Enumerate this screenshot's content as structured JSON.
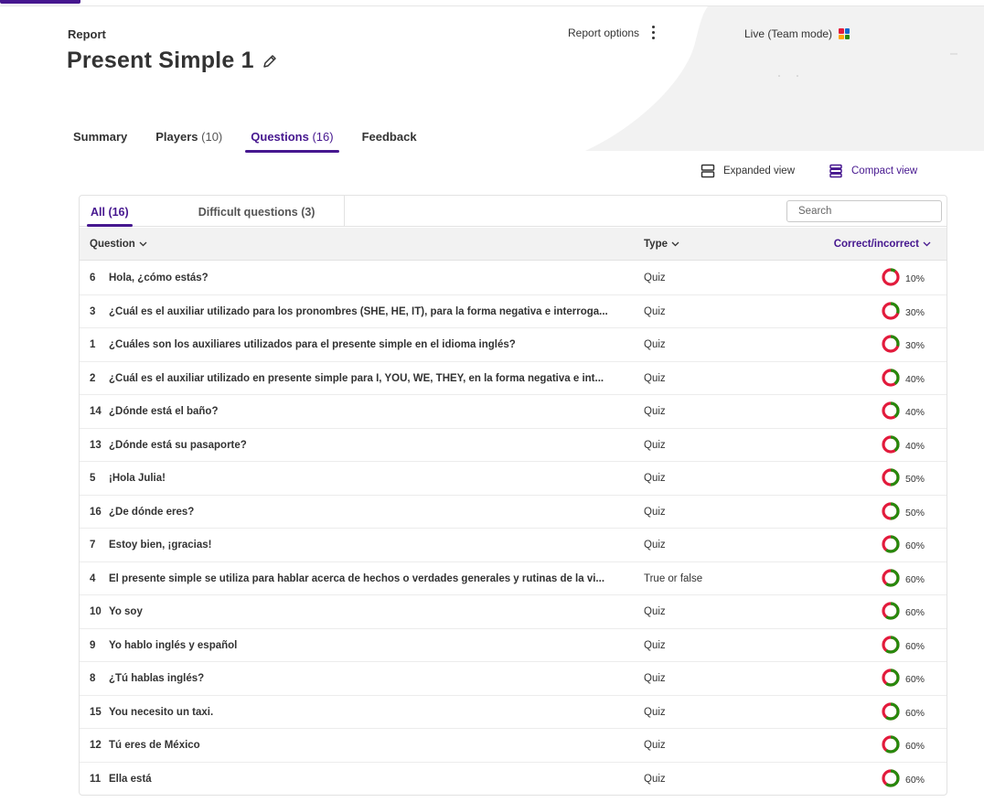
{
  "header": {
    "label": "Report",
    "title": "Present Simple 1",
    "options_label": "Report options",
    "mode_label": "Live (Team mode)"
  },
  "tabs": [
    {
      "label": "Summary",
      "count": ""
    },
    {
      "label": "Players",
      "count": "(10)"
    },
    {
      "label": "Questions",
      "count": "(16)"
    },
    {
      "label": "Feedback",
      "count": ""
    }
  ],
  "view_toggle": {
    "expanded_label": "Expanded view",
    "compact_label": "Compact view",
    "selected": "compact"
  },
  "subtabs": {
    "all_label": "All (16)",
    "difficult_label": "Difficult questions (3)"
  },
  "search": {
    "placeholder": "Search",
    "value": ""
  },
  "table": {
    "headers": {
      "question": "Question",
      "type": "Type",
      "correct": "Correct/incorrect"
    },
    "rows": [
      {
        "num": "6",
        "question": "Hola, ¿cómo estás?",
        "type": "Quiz",
        "correct_pct": "10%",
        "correct": 10
      },
      {
        "num": "3",
        "question": "¿Cuál es el auxiliar utilizado para los pronombres (SHE, HE, IT), para la forma negativa e interroga...",
        "type": "Quiz",
        "correct_pct": "30%",
        "correct": 30
      },
      {
        "num": "1",
        "question": "¿Cuáles son los auxiliares utilizados para el presente simple en el idioma inglés?",
        "type": "Quiz",
        "correct_pct": "30%",
        "correct": 30
      },
      {
        "num": "2",
        "question": "¿Cuál es el auxiliar utilizado en presente simple para I, YOU, WE, THEY, en la forma negativa e int...",
        "type": "Quiz",
        "correct_pct": "40%",
        "correct": 40
      },
      {
        "num": "14",
        "question": "¿Dónde está el baño?",
        "type": "Quiz",
        "correct_pct": "40%",
        "correct": 40
      },
      {
        "num": "13",
        "question": "¿Dónde está su pasaporte?",
        "type": "Quiz",
        "correct_pct": "40%",
        "correct": 40
      },
      {
        "num": "5",
        "question": "¡Hola Julia!",
        "type": "Quiz",
        "correct_pct": "50%",
        "correct": 50
      },
      {
        "num": "16",
        "question": "¿De dónde eres?",
        "type": "Quiz",
        "correct_pct": "50%",
        "correct": 50
      },
      {
        "num": "7",
        "question": "Estoy bien, ¡gracias!",
        "type": "Quiz",
        "correct_pct": "60%",
        "correct": 60
      },
      {
        "num": "4",
        "question": "El presente simple se utiliza para hablar acerca de hechos o verdades generales y rutinas de la vi...",
        "type": "True or false",
        "correct_pct": "60%",
        "correct": 60
      },
      {
        "num": "10",
        "question": "Yo soy",
        "type": "Quiz",
        "correct_pct": "60%",
        "correct": 60
      },
      {
        "num": "9",
        "question": "Yo hablo inglés y español",
        "type": "Quiz",
        "correct_pct": "60%",
        "correct": 60
      },
      {
        "num": "8",
        "question": "¿Tú hablas inglés?",
        "type": "Quiz",
        "correct_pct": "60%",
        "correct": 60
      },
      {
        "num": "15",
        "question": "You necesito un taxi.",
        "type": "Quiz",
        "correct_pct": "60%",
        "correct": 60
      },
      {
        "num": "12",
        "question": "Tú eres de México",
        "type": "Quiz",
        "correct_pct": "60%",
        "correct": 60
      },
      {
        "num": "11",
        "question": "Ella está",
        "type": "Quiz",
        "correct_pct": "60%",
        "correct": 60
      }
    ]
  },
  "colors": {
    "accent": "#46178f",
    "correct": "#26890c",
    "incorrect": "#e21b3c",
    "team_icon": [
      "#e21b3c",
      "#1368ce",
      "#ffa602",
      "#26890c"
    ]
  },
  "icons": {
    "edit": "pencil-icon",
    "options": "kebab-menu-icon",
    "team_mode": "team-mode-icon",
    "expanded_view": "expanded-view-icon",
    "compact_view": "compact-view-icon",
    "sort": "chevron-down-icon"
  }
}
